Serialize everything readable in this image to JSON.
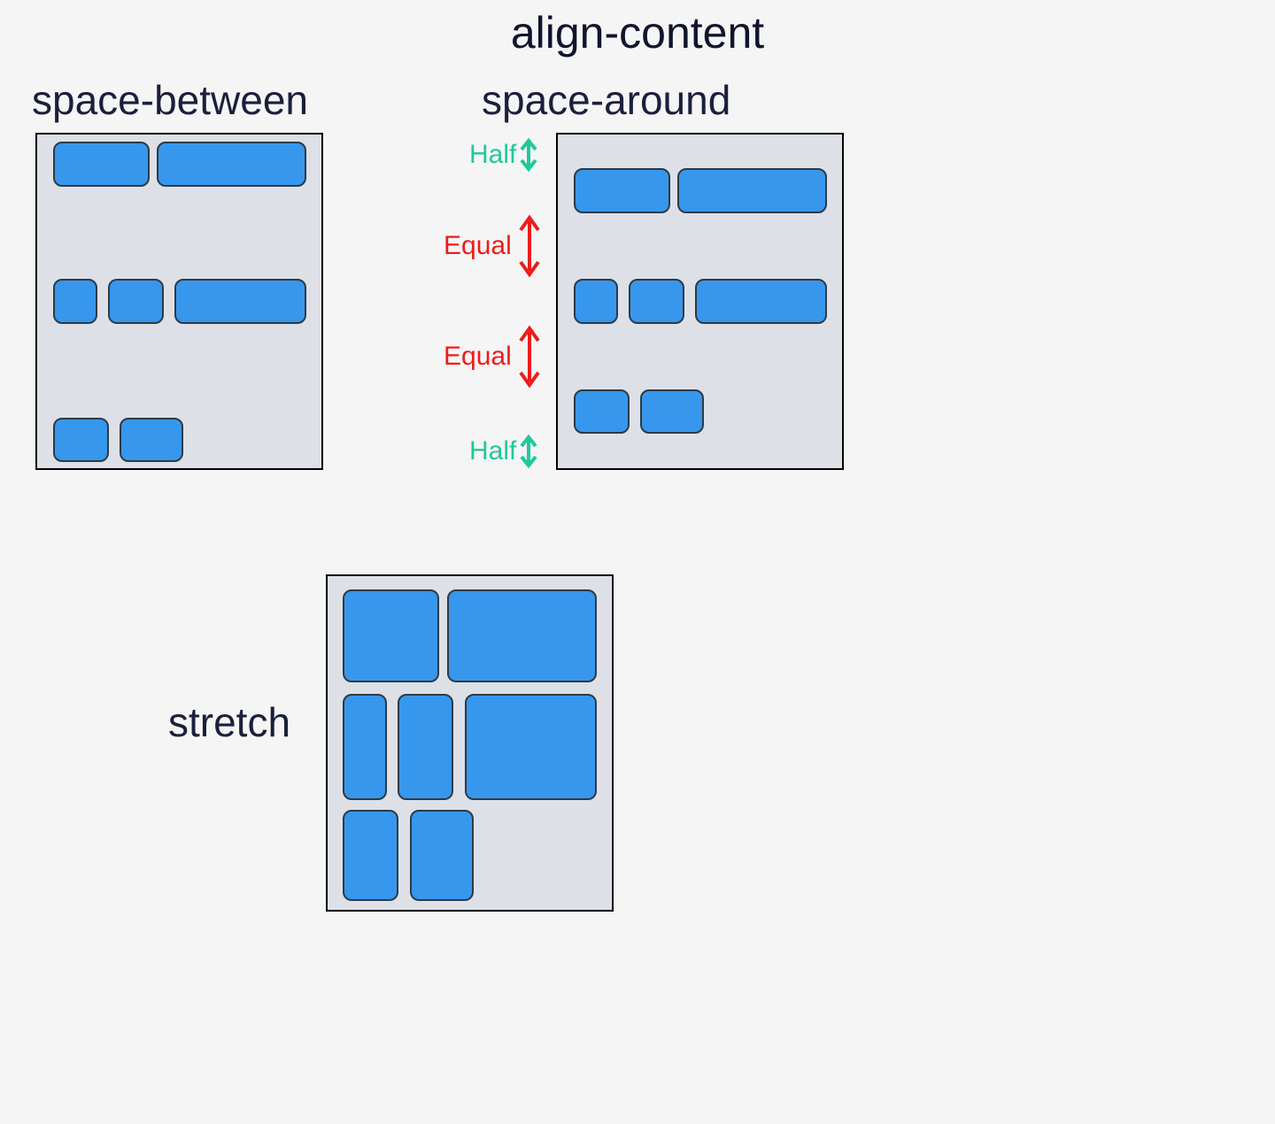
{
  "title": "align-content",
  "diagram": {
    "spaceBetween": {
      "label": "space-between"
    },
    "spaceAround": {
      "label": "space-around",
      "annotations": {
        "topHalf": "Half",
        "gap1": "Equal",
        "gap2": "Equal",
        "bottomHalf": "Half"
      }
    },
    "stretch": {
      "label": "stretch"
    }
  },
  "colors": {
    "item": "#3797ec",
    "container": "#dde1e7",
    "equal": "#ef1b1b",
    "half": "#1fc99a",
    "text": "#11142d"
  }
}
